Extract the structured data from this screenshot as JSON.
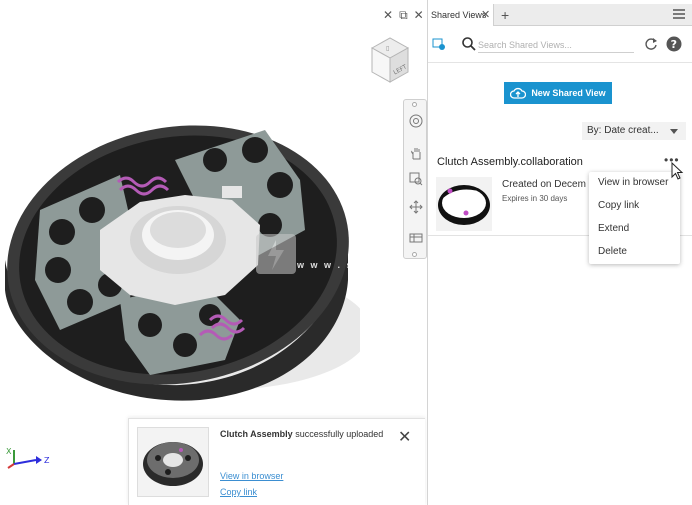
{
  "viewport": {
    "viewcube_label": "LEFT",
    "axis": {
      "x_label": "X",
      "z_label": "Z"
    },
    "navbar_tools": [
      "steering-wheel-icon",
      "pan-icon",
      "zoom-window-icon",
      "orbit-icon",
      "look-at-icon"
    ],
    "model_colors": {
      "housing": "#2a2a2a",
      "plates": "#8e9a98",
      "center": "#e6e6e6",
      "coils": "#b45bb6"
    }
  },
  "notification": {
    "title": "Clutch Assembly",
    "message": "successfully uploaded",
    "view_link": "View in browser",
    "copy_link": "Copy link"
  },
  "panel": {
    "tab_label": "Shared Views",
    "search_placeholder": "Search Shared Views...",
    "new_button": "New Shared View",
    "sort_label": "By: Date creat...",
    "card": {
      "title": "Clutch Assembly.collaboration",
      "created": "Created on Decem",
      "expires": "Expires in 30 days",
      "more": "•••"
    },
    "menu": [
      "View in browser",
      "Copy link",
      "Extend",
      "Delete"
    ]
  },
  "watermark": {
    "text": "w w w . s d"
  },
  "colors": {
    "accent": "#1a93cf",
    "link": "#3b8ed1"
  }
}
